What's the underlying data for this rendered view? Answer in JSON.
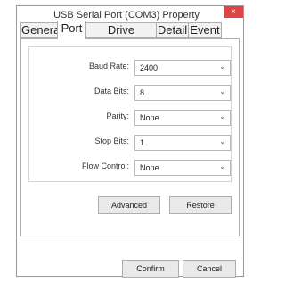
{
  "window": {
    "title": "USB Serial Port (COM3) Property",
    "close_glyph": "×"
  },
  "tabs": [
    {
      "label": "General",
      "active": false
    },
    {
      "label": "Port",
      "active": true
    },
    {
      "label": "Drive Program",
      "active": false
    },
    {
      "label": "Detail",
      "active": false
    },
    {
      "label": "Event",
      "active": false
    }
  ],
  "port_settings": [
    {
      "label": "Baud Rate:",
      "value": "2400"
    },
    {
      "label": "Data Bits:",
      "value": "8"
    },
    {
      "label": "Parity:",
      "value": "None"
    },
    {
      "label": "Stop Bits:",
      "value": "1"
    },
    {
      "label": "Flow Control:",
      "value": "None"
    }
  ],
  "buttons": {
    "advanced": "Advanced",
    "restore": "Restore",
    "confirm": "Confirm",
    "cancel": "Cancel"
  },
  "icons": {
    "dropdown": "chevron-down-icon",
    "close": "close-icon"
  },
  "colors": {
    "close_button": "#e04343"
  }
}
